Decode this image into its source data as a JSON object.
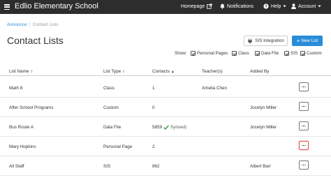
{
  "topbar": {
    "brand": "Edlio Elementary School",
    "homepage": "Homepage",
    "notifications": "Notifications",
    "help": "Help",
    "account": "Account"
  },
  "breadcrumb": {
    "parent": "Announce",
    "separator": "/",
    "current": "Contact Lists"
  },
  "page": {
    "title": "Contact Lists",
    "sis_button": "SIS Integration",
    "new_button": "New List"
  },
  "filters": {
    "label": "Show:",
    "options": [
      {
        "label": "Personal Pages",
        "checked": true
      },
      {
        "label": "Class",
        "checked": true
      },
      {
        "label": "Data File",
        "checked": true
      },
      {
        "label": "SIS",
        "checked": true
      },
      {
        "label": "Custom",
        "checked": true
      }
    ]
  },
  "table": {
    "columns": [
      "List Name",
      "List Type",
      "Contacts",
      "Teacher(s)",
      "Added By"
    ],
    "rows": [
      {
        "name": "Math 8",
        "type": "Class",
        "contacts": "1",
        "teacher": "Amelia Chen",
        "added_by": ""
      },
      {
        "name": "After School Programs",
        "type": "Custom",
        "contacts": "0",
        "teacher": "",
        "added_by": "Jocelyn Miller"
      },
      {
        "name": "Bus Route A",
        "type": "Data File",
        "contacts": "5859",
        "synced": "Synced)",
        "teacher": "",
        "added_by": "Jocelyn Miller"
      },
      {
        "name": "Mary Hopkins",
        "type": "Personal Page",
        "contacts": "2",
        "teacher": "",
        "added_by": ""
      },
      {
        "name": "All Staff",
        "type": "SIS",
        "contacts": "862",
        "teacher": "",
        "added_by": "Albert Barr"
      }
    ]
  },
  "colors": {
    "topbar": "#2d2d2d",
    "accent": "#2a8cd8",
    "synced_check": "#3aa34a"
  }
}
